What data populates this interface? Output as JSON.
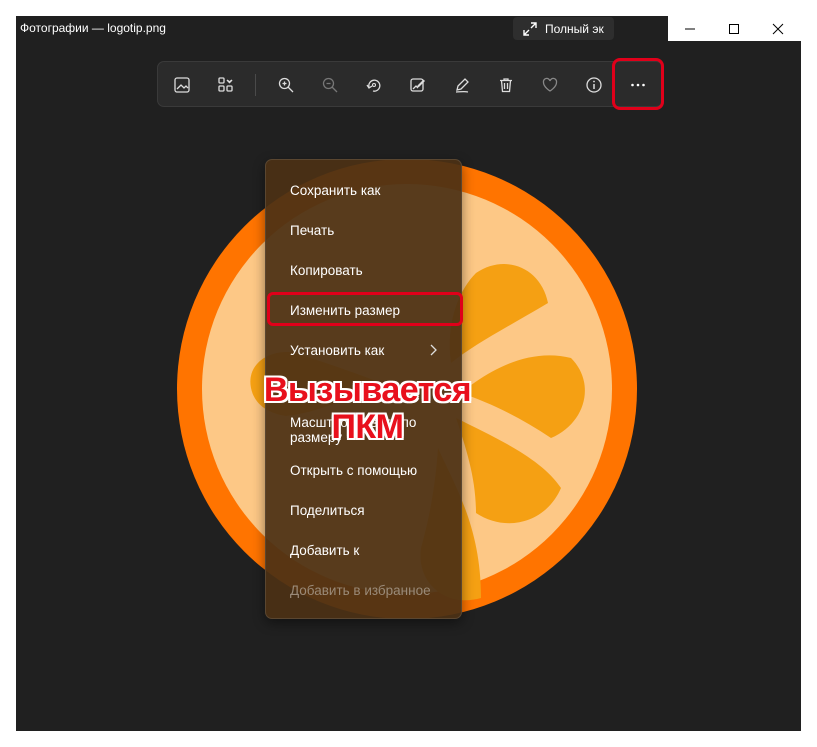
{
  "window": {
    "title": "Фотографии — logotip.png",
    "fullscreen_label": "Полный эк"
  },
  "toolbar": {
    "icons": [
      "photo-icon",
      "gallery-icon",
      "zoom-in-icon",
      "zoom-out-icon",
      "rotate-icon",
      "edit-image-icon",
      "draw-icon",
      "delete-icon",
      "favorite-icon",
      "info-icon",
      "more-icon"
    ]
  },
  "context_menu": {
    "items": [
      {
        "label": "Сохранить как",
        "enabled": true
      },
      {
        "label": "Печать",
        "enabled": true
      },
      {
        "label": "Копировать",
        "enabled": true
      },
      {
        "label": "Изменить размер",
        "enabled": true
      },
      {
        "label": "Установить как",
        "enabled": true,
        "submenu": true
      },
      {
        "label": "Масштабировать по размеру",
        "enabled": true
      },
      {
        "label": "Открыть с помощью",
        "enabled": true
      },
      {
        "label": "Поделиться",
        "enabled": true
      },
      {
        "label": "Добавить к",
        "enabled": true
      },
      {
        "label": "Добавить в избранное",
        "enabled": false
      }
    ]
  },
  "annotation": {
    "line1": "Вызывается",
    "line2": "ПКМ",
    "color": "#e8101c"
  },
  "colors": {
    "background": "#202020",
    "orange_outer": "#ff7400",
    "orange_inner": "#fdc886",
    "segments": "#f5a013",
    "highlight": "#e0001a"
  }
}
